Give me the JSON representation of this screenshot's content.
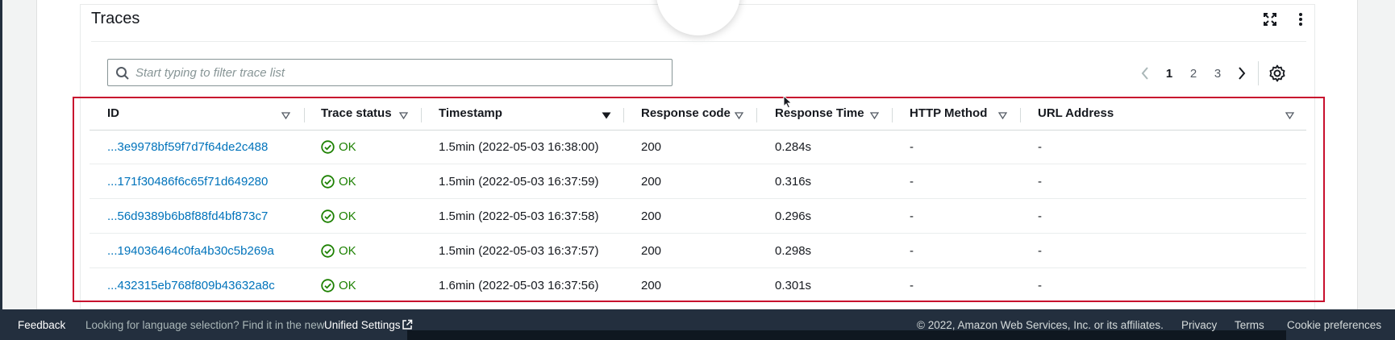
{
  "panel": {
    "title": "Traces"
  },
  "search": {
    "placeholder": "Start typing to filter trace list",
    "value": ""
  },
  "pagination": {
    "pages": [
      "1",
      "2",
      "3"
    ],
    "current": "1"
  },
  "table": {
    "columns": [
      "ID",
      "Trace status",
      "Timestamp",
      "Response code",
      "Response Time",
      "HTTP Method",
      "URL Address"
    ],
    "sorted_column": "Timestamp",
    "sort_direction": "descending",
    "rows": [
      {
        "id": "...3e9978bf59f7d7f64de2c488",
        "status": "OK",
        "timestamp": "1.5min (2022-05-03 16:38:00)",
        "response_code": "200",
        "response_time": "0.284s",
        "http_method": "-",
        "url": "-"
      },
      {
        "id": "...171f30486f6c65f71d649280",
        "status": "OK",
        "timestamp": "1.5min (2022-05-03 16:37:59)",
        "response_code": "200",
        "response_time": "0.316s",
        "http_method": "-",
        "url": "-"
      },
      {
        "id": "...56d9389b6b8f88fd4bf873c7",
        "status": "OK",
        "timestamp": "1.5min (2022-05-03 16:37:58)",
        "response_code": "200",
        "response_time": "0.296s",
        "http_method": "-",
        "url": "-"
      },
      {
        "id": "...194036464c0fa4b30c5b269a",
        "status": "OK",
        "timestamp": "1.5min (2022-05-03 16:37:57)",
        "response_code": "200",
        "response_time": "0.298s",
        "http_method": "-",
        "url": "-"
      },
      {
        "id": "...432315eb768f809b43632a8c",
        "status": "OK",
        "timestamp": "1.6min (2022-05-03 16:37:56)",
        "response_code": "200",
        "response_time": "0.301s",
        "http_method": "-",
        "url": "-"
      }
    ]
  },
  "footer": {
    "feedback": "Feedback",
    "language_message": "Looking for language selection? Find it in the new",
    "unified_settings": "Unified Settings",
    "copyright": "© 2022, Amazon Web Services, Inc. or its affiliates.",
    "privacy": "Privacy",
    "terms": "Terms",
    "cookie_preferences": "Cookie preferences"
  },
  "icons": {
    "expand": "expand-icon",
    "more": "kebab-menu-icon",
    "search": "search-icon",
    "prev": "chevron-left-icon",
    "next": "chevron-right-icon",
    "settings": "gear-icon",
    "status_ok": "check-circle-icon",
    "sort": "sort-caret-icon",
    "external": "external-link-icon"
  },
  "colors": {
    "link": "#0073bb",
    "status_ok": "#1d8102",
    "highlight_outline": "#c8102e",
    "footer_bg": "#232f3e"
  }
}
